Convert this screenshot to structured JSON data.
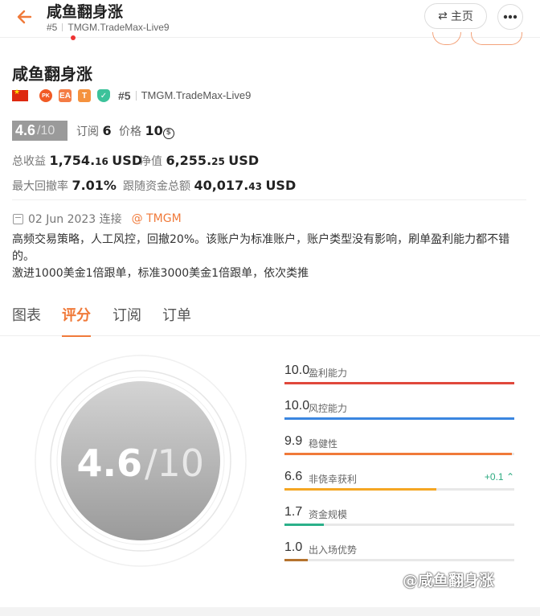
{
  "header": {
    "title": "咸鱼翻身涨",
    "rank": "#5",
    "server": "TMGM.TradeMax-Live9",
    "home_label": "主页"
  },
  "profile": {
    "name": "咸鱼翻身涨",
    "badges": [
      "PK",
      "EA",
      "T"
    ],
    "rank": "#5",
    "server": "TMGM.TradeMax-Live9",
    "score": "4.6",
    "score_den": "/10",
    "subs_label": "订阅",
    "subs_value": "6",
    "price_label": "价格",
    "price_value": "10",
    "price_coin": "$",
    "total_profit_label": "总收益",
    "total_profit_main": "1,754.",
    "total_profit_dec": "16",
    "total_profit_unit": "USD",
    "equity_label": "净值",
    "equity_main": "6,255.",
    "equity_dec": "25",
    "equity_unit": "USD",
    "max_drawdown_label": "最大回撤率",
    "max_drawdown_value": "7.01%",
    "follow_funds_label": "跟随资金总额",
    "follow_funds_main": "40,017.",
    "follow_funds_dec": "43",
    "follow_funds_unit": "USD",
    "date": "02 Jun 2023 连接",
    "broker": "@ TMGM",
    "description_line1": "高频交易策略，人工风控，回撤20%。该账户为标准账户，账户类型没有影响，刷单盈利能力都不错的。",
    "description_line2": "激进1000美金1倍跟单，标准3000美金1倍跟单，依次类推"
  },
  "tabs": [
    "图表",
    "评分",
    "订阅",
    "订单"
  ],
  "active_tab": "评分",
  "rating": {
    "score": "4.6",
    "den": "/10",
    "items": [
      {
        "value": "10.0",
        "label": "盈利能力",
        "fraction": 1.0,
        "color": "#e0483c"
      },
      {
        "value": "10.0",
        "label": "风控能力",
        "fraction": 1.0,
        "color": "#3b86e0"
      },
      {
        "value": "9.9",
        "label": "稳健性",
        "fraction": 0.99,
        "color": "#f07a3a"
      },
      {
        "value": "6.6",
        "label": "非侥幸获利",
        "fraction": 0.66,
        "color": "#f5a623",
        "delta": "+0.1"
      },
      {
        "value": "1.7",
        "label": "资金规模",
        "fraction": 0.17,
        "color": "#2bb08a"
      },
      {
        "value": "1.0",
        "label": "出入场优势",
        "fraction": 0.1,
        "color": "#b5732e"
      }
    ]
  },
  "watermark": "@咸鱼翻身涨"
}
